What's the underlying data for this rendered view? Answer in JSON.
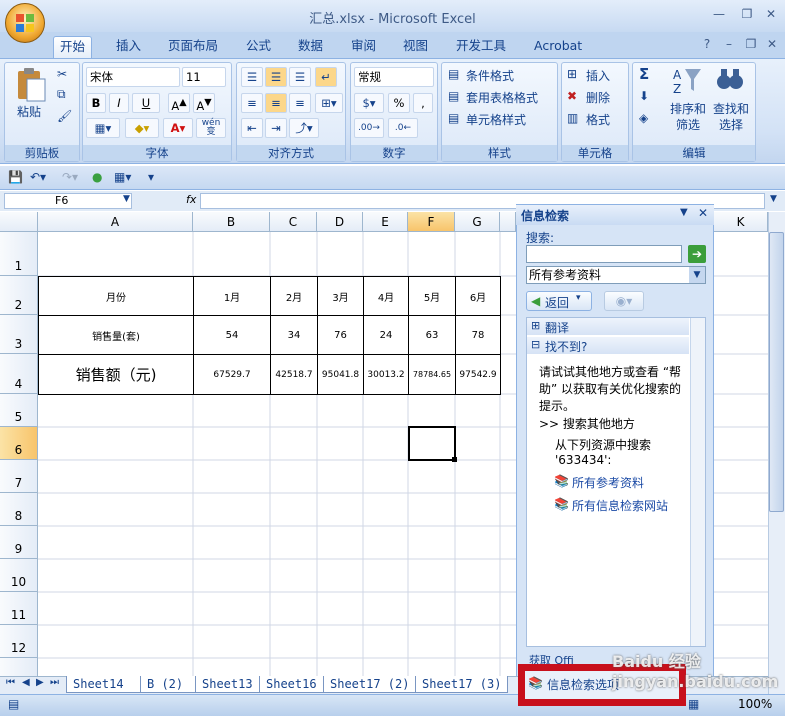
{
  "window": {
    "title": "汇总.xlsx - Microsoft Excel"
  },
  "tabs": [
    "开始",
    "插入",
    "页面布局",
    "公式",
    "数据",
    "审阅",
    "视图",
    "开发工具",
    "Acrobat"
  ],
  "ribbon": {
    "clipboard": {
      "label": "剪贴板",
      "paste": "粘贴"
    },
    "font": {
      "label": "字体",
      "name": "宋体",
      "size": "11",
      "bold": "B",
      "italic": "I",
      "underline": "U",
      "wen": "wén\n变"
    },
    "alignment": {
      "label": "对齐方式"
    },
    "number": {
      "label": "数字",
      "format": "常规",
      "percent": "%",
      "comma": ","
    },
    "styles": {
      "label": "样式",
      "conditional": "条件格式",
      "table": "套用表格格式",
      "cell": "单元格样式"
    },
    "cells": {
      "label": "单元格",
      "insert": "插入",
      "delete": "删除",
      "format": "格式"
    },
    "editing": {
      "label": "编辑",
      "sort": "排序和\n筛选",
      "find": "查找和\n选择",
      "sigma": "Σ"
    }
  },
  "formula_bar": {
    "name_box": "F6",
    "fx": "fx"
  },
  "columns": [
    "A",
    "B",
    "C",
    "D",
    "E",
    "F",
    "G",
    "",
    "K"
  ],
  "rows": [
    "1",
    "2",
    "3",
    "4",
    "5",
    "6",
    "7",
    "8",
    "9",
    "10",
    "11",
    "12"
  ],
  "table": {
    "header": [
      "月份",
      "1月",
      "2月",
      "3月",
      "4月",
      "5月",
      "6月"
    ],
    "row1": [
      "销售量(套)",
      "54",
      "34",
      "76",
      "24",
      "63",
      "78"
    ],
    "row2": [
      "销售额（元)",
      "67529.7",
      "42518.7",
      "95041.8",
      "30013.2",
      "78784.65",
      "97542.9"
    ]
  },
  "research": {
    "title": "信息检索",
    "search_label": "搜索:",
    "source": "所有参考资料",
    "back": "返回",
    "translate": "翻译",
    "notfound": "找不到?",
    "body": "请试试其他地方或查看 “帮助” 以获取有关优化搜索的提示。",
    "search_elsewhere": ">>  搜索其他地方",
    "from_below": "从下列资源中搜索",
    "query": "'633434':",
    "link1": "所有参考资料",
    "link2": "所有信息检索网站",
    "get_more": "获取 Offi",
    "options": "信息检索选项"
  },
  "sheets": [
    "Sheet14",
    "B (2)",
    "Sheet13",
    "Sheet16",
    "Sheet17 (2)",
    "Sheet17 (3)"
  ],
  "status": {
    "zoom": "100%"
  },
  "watermark": "Baidu 经验 jingyan.baidu.com"
}
